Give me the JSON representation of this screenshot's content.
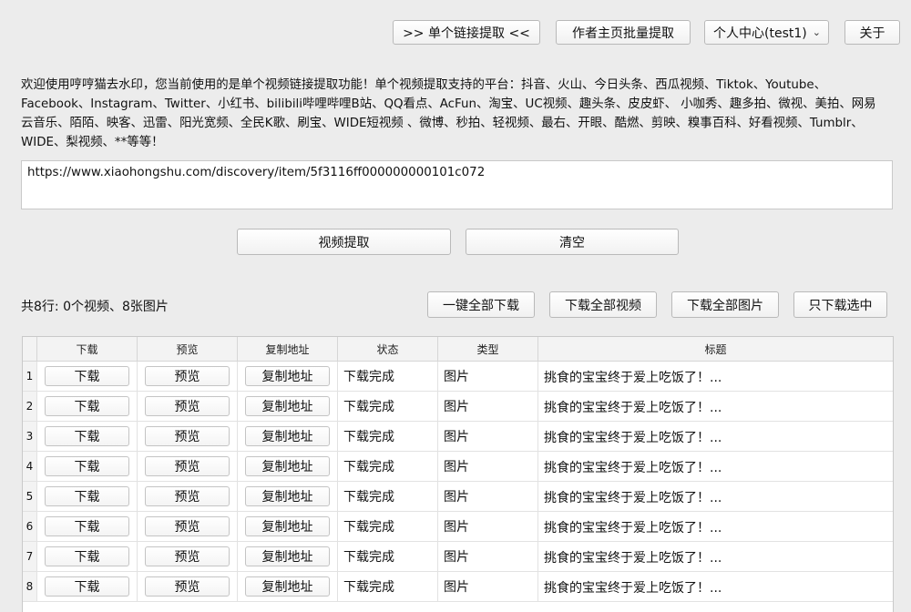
{
  "header": {
    "single_link_btn": ">> 单个链接提取 <<",
    "batch_btn": "作者主页批量提取",
    "user_select": "个人中心(test1)",
    "about_btn": "关于"
  },
  "notice": "欢迎使用哼哼猫去水印，您当前使用的是单个视频链接提取功能！单个视频提取支持的平台：抖音、火山、今日头条、西瓜视频、Tiktok、Youtube、Facebook、Instagram、Twitter、小红书、bilibili哔哩哔哩B站、QQ看点、AcFun、淘宝、UC视频、趣头条、皮皮虾、 小咖秀、趣多拍、微视、美拍、网易云音乐、陌陌、映客、迅雷、阳光宽频、全民K歌、刷宝、WIDE短视频 、微博、秒拍、轻视频、最右、开眼、酷燃、剪映、糗事百科、好看视频、Tumblr、WIDE、梨视频、**等等！",
  "url_input": "https://www.xiaohongshu.com/discovery/item/5f3116ff000000000101c072",
  "actions": {
    "extract": "视频提取",
    "clear": "清空"
  },
  "summary": "共8行: 0个视频、8张图片",
  "bulk": {
    "download_all": "一键全部下载",
    "download_videos": "下载全部视频",
    "download_images": "下载全部图片",
    "download_selected": "只下载选中"
  },
  "columns": [
    "下载",
    "预览",
    "复制地址",
    "状态",
    "类型",
    "标题"
  ],
  "rows": [
    {
      "num": "1",
      "download": "下载",
      "preview": "预览",
      "copy": "复制地址",
      "status": "下载完成",
      "type": "图片",
      "title": "挑食的宝宝终于爱上吃饭了！..."
    },
    {
      "num": "2",
      "download": "下载",
      "preview": "预览",
      "copy": "复制地址",
      "status": "下载完成",
      "type": "图片",
      "title": "挑食的宝宝终于爱上吃饭了！..."
    },
    {
      "num": "3",
      "download": "下载",
      "preview": "预览",
      "copy": "复制地址",
      "status": "下载完成",
      "type": "图片",
      "title": "挑食的宝宝终于爱上吃饭了！..."
    },
    {
      "num": "4",
      "download": "下载",
      "preview": "预览",
      "copy": "复制地址",
      "status": "下载完成",
      "type": "图片",
      "title": "挑食的宝宝终于爱上吃饭了！..."
    },
    {
      "num": "5",
      "download": "下载",
      "preview": "预览",
      "copy": "复制地址",
      "status": "下载完成",
      "type": "图片",
      "title": "挑食的宝宝终于爱上吃饭了！..."
    },
    {
      "num": "6",
      "download": "下载",
      "preview": "预览",
      "copy": "复制地址",
      "status": "下载完成",
      "type": "图片",
      "title": "挑食的宝宝终于爱上吃饭了！..."
    },
    {
      "num": "7",
      "download": "下载",
      "preview": "预览",
      "copy": "复制地址",
      "status": "下载完成",
      "type": "图片",
      "title": "挑食的宝宝终于爱上吃饭了！..."
    },
    {
      "num": "8",
      "download": "下载",
      "preview": "预览",
      "copy": "复制地址",
      "status": "下载完成",
      "type": "图片",
      "title": "挑食的宝宝终于爱上吃饭了！..."
    }
  ]
}
